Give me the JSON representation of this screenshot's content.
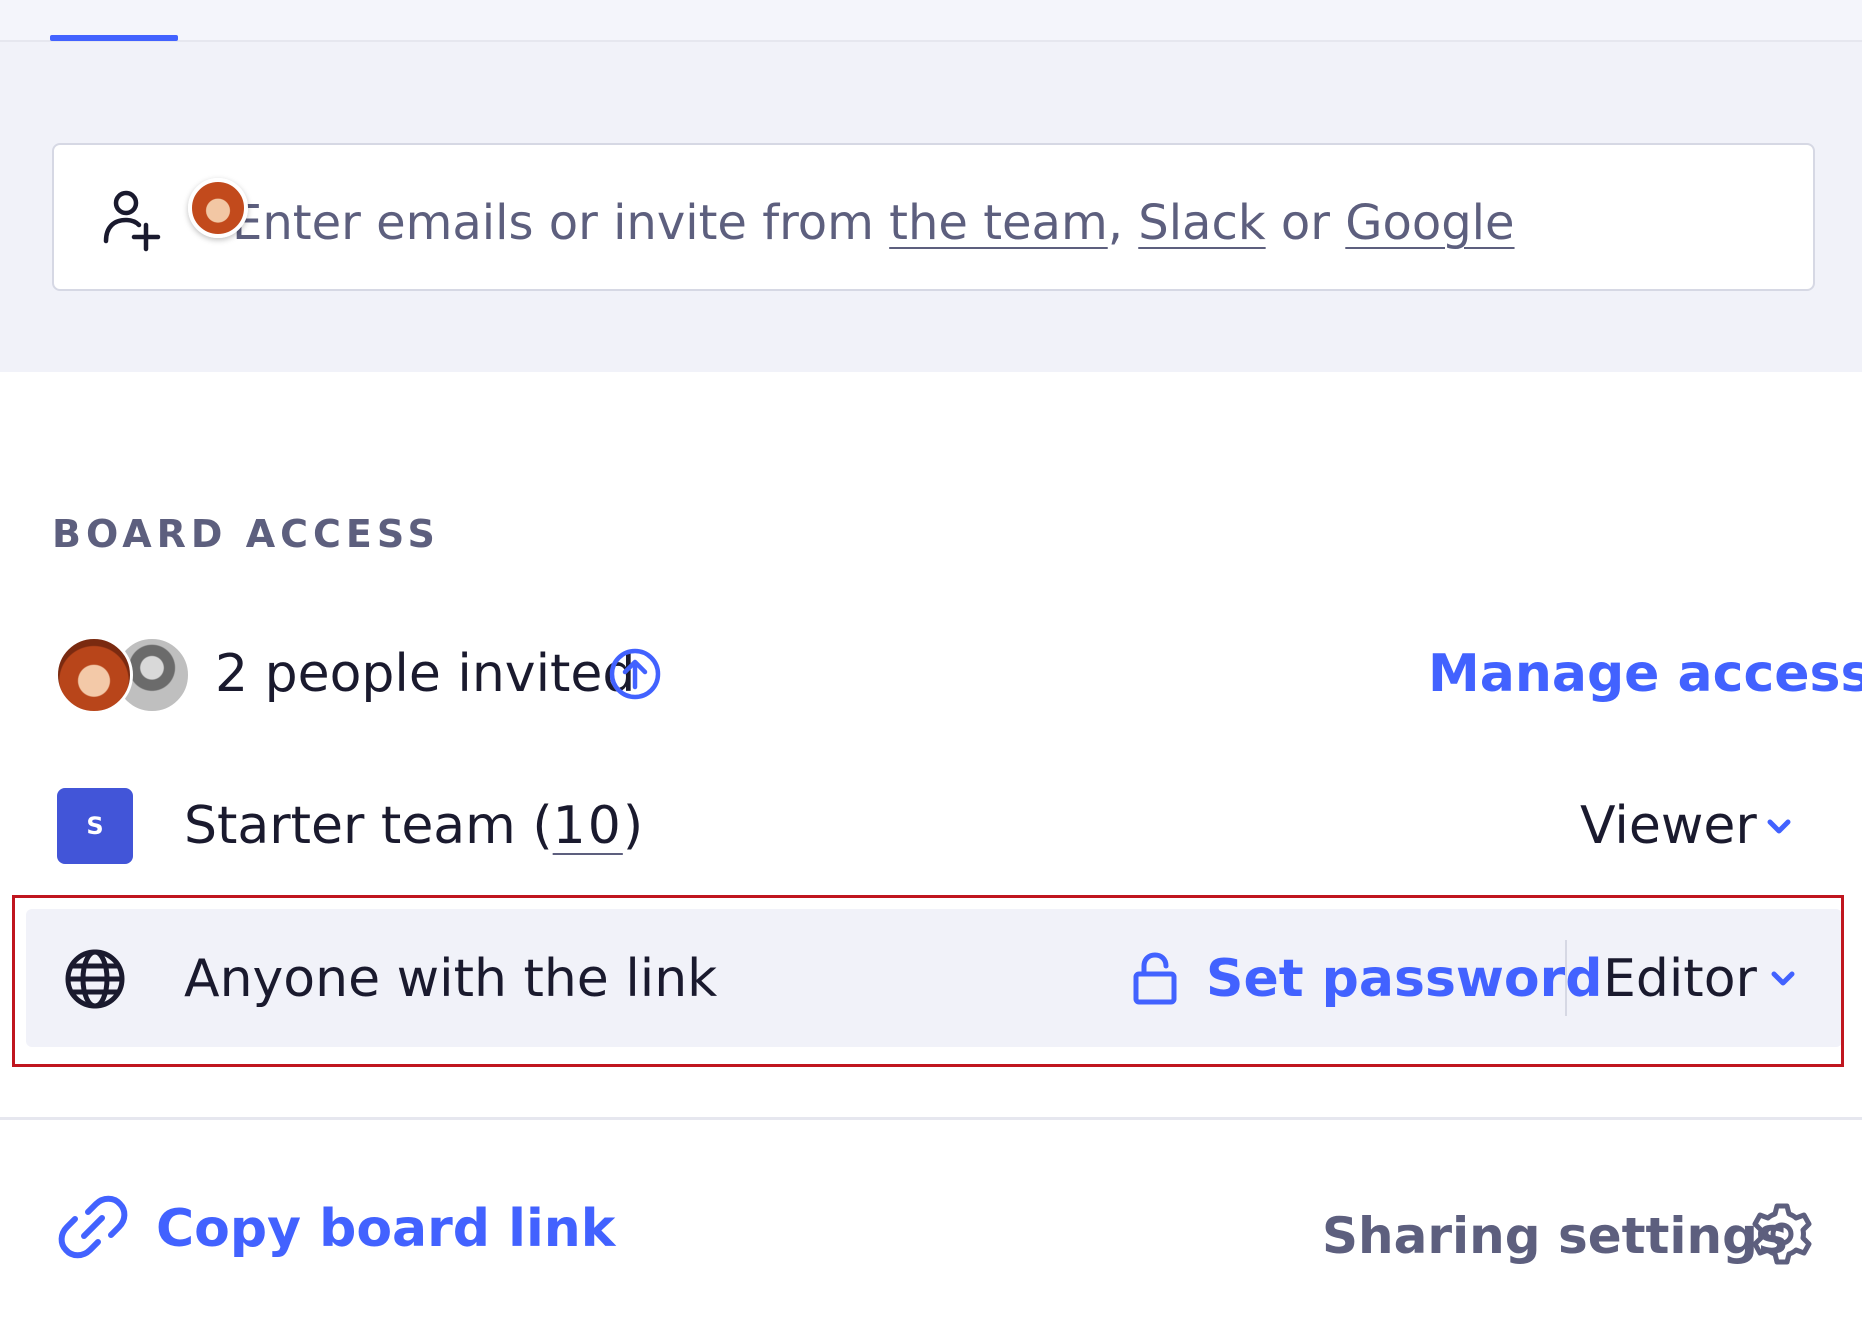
{
  "invite": {
    "placeholder_prefix": "Enter emails or invite from ",
    "link_team": "the team",
    "separator": ", ",
    "link_slack": "Slack",
    "or_text": " or ",
    "link_google": "Google"
  },
  "board_access": {
    "title": "BOARD ACCESS",
    "invited": {
      "label": "2 people invited",
      "action": "Manage access"
    },
    "team": {
      "badge": "S",
      "name": "Starter team (",
      "count": "10",
      "close": ")",
      "role": "Viewer"
    },
    "link": {
      "label": "Anyone with the link",
      "password_action": "Set password",
      "role": "Editor"
    }
  },
  "footer": {
    "copy_link": "Copy board link",
    "sharing_settings": "Sharing settings"
  },
  "colors": {
    "accent": "#4262ff",
    "team_badge": "#4255d8",
    "highlight_border": "#c0161f",
    "muted_text": "#5d5f7e"
  },
  "icons": [
    "add-user-icon",
    "upgrade-icon",
    "chevron-down-icon",
    "globe-icon",
    "lock-icon",
    "link-icon",
    "gear-icon"
  ]
}
